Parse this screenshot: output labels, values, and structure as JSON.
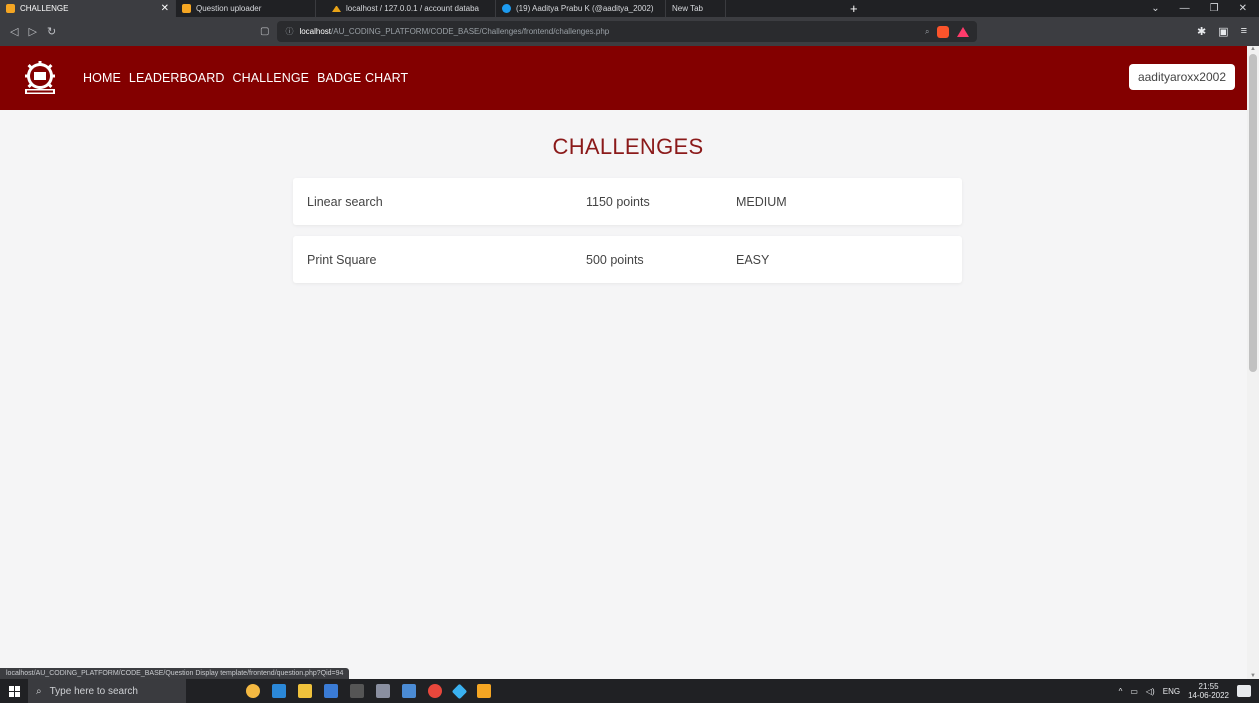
{
  "browser": {
    "tabs": [
      {
        "label": "CHALLENGE",
        "favicon": "orange-square-icon",
        "active": true
      },
      {
        "label": "Question uploader",
        "favicon": "orange-square-icon"
      },
      {
        "label": "localhost / 127.0.0.1 / account databa",
        "favicon": "phpmyadmin-icon"
      },
      {
        "label": "(19) Aaditya Prabu K (@aaditya_2002)",
        "favicon": "twitter-icon"
      },
      {
        "label": "New Tab",
        "favicon": ""
      }
    ],
    "url_host": "localhost",
    "url_path": "/AU_CODING_PLATFORM/CODE_BASE/Challenges/frontend/challenges.php",
    "status_url": "localhost/AU_CODING_PLATFORM/CODE_BASE/Question Display template/frontend/question.php?Qid=94"
  },
  "header": {
    "nav": [
      "HOME",
      "LEADERBOARD",
      "CHALLENGE",
      "BADGE CHART"
    ],
    "username": "aadityaroxx2002",
    "bg_color": "#830000"
  },
  "main": {
    "title": "CHALLENGES",
    "challenges": [
      {
        "name": "Linear search",
        "points": "1150 points",
        "difficulty": "MEDIUM"
      },
      {
        "name": "Print Square",
        "points": "500 points",
        "difficulty": "EASY"
      }
    ]
  },
  "taskbar": {
    "search_placeholder": "Type here to search",
    "tray_lang": "ENG",
    "time": "21:55",
    "date": "14-06-2022"
  }
}
